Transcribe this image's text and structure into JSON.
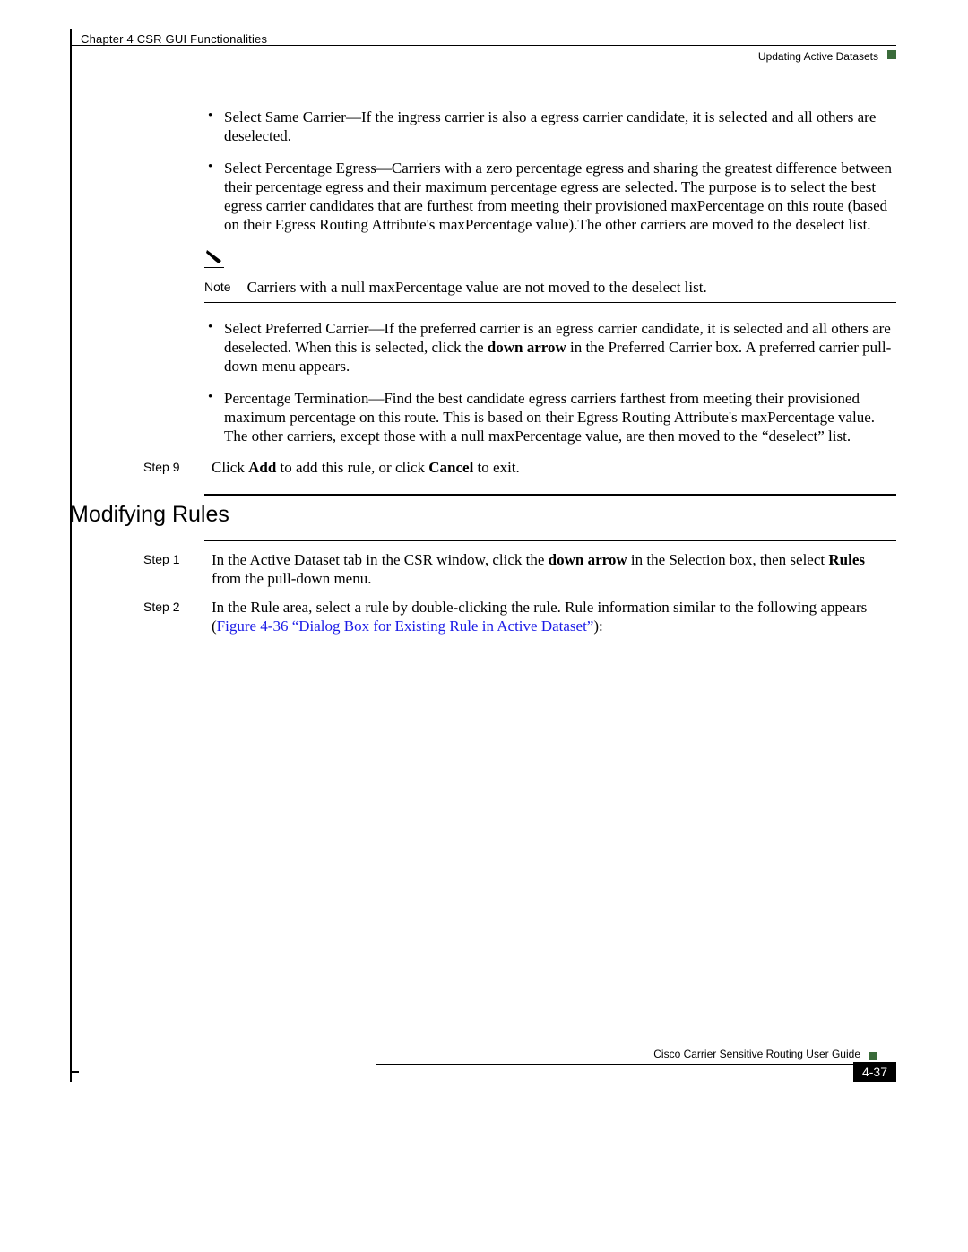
{
  "header": {
    "chapter": "Chapter 4    CSR GUI Functionalities",
    "subsection": "Updating Active Datasets"
  },
  "bullets1": [
    "Select Same Carrier—If the ingress carrier is also a egress carrier candidate, it is selected and all others are deselected.",
    "Select Percentage Egress—Carriers with a zero percentage egress and sharing the greatest difference between their percentage egress and their maximum percentage egress are selected. The purpose is to select the best egress carrier candidates that are furthest from meeting their provisioned maxPercentage on this route (based on their Egress Routing Attribute's maxPercentage value).The other carriers are moved to the deselect list."
  ],
  "note": {
    "label": "Note",
    "text": "Carriers with a null maxPercentage value are not moved to the deselect list."
  },
  "bullets2": [
    {
      "pre": "Select Preferred Carrier—If the preferred carrier is an egress carrier candidate, it is selected and all others are deselected. When this is selected, click the ",
      "bold": "down arrow",
      "post": " in the Preferred Carrier box. A preferred carrier pull-down menu appears."
    },
    {
      "pre": "Percentage Termination—Find the best candidate egress carriers farthest from meeting their provisioned maximum percentage on this route. This is based on their Egress Routing Attribute's maxPercentage value. The other carriers, except those with a null maxPercentage value, are then moved to the “deselect” list.",
      "bold": "",
      "post": ""
    }
  ],
  "step9": {
    "label": "Step 9",
    "pre": "Click ",
    "b1": "Add",
    "mid": " to add this rule, or click ",
    "b2": "Cancel",
    "post": " to exit."
  },
  "heading2": "Modifying Rules",
  "steps2": [
    {
      "label": "Step 1",
      "pre": "In the Active Dataset tab in the CSR window, click the ",
      "b1": "down arrow",
      "mid": " in the Selection box, then select ",
      "b2": "Rules",
      "post": " from the pull-down menu."
    },
    {
      "label": "Step 2",
      "pre": "In the Rule area, select a rule by double-clicking the rule. Rule information similar to the following appears (",
      "link": "Figure 4-36 “Dialog Box for Existing Rule in Active Dataset”",
      "post": "):"
    }
  ],
  "footer": {
    "title": "Cisco Carrier Sensitive Routing User Guide",
    "page": "4-37"
  }
}
